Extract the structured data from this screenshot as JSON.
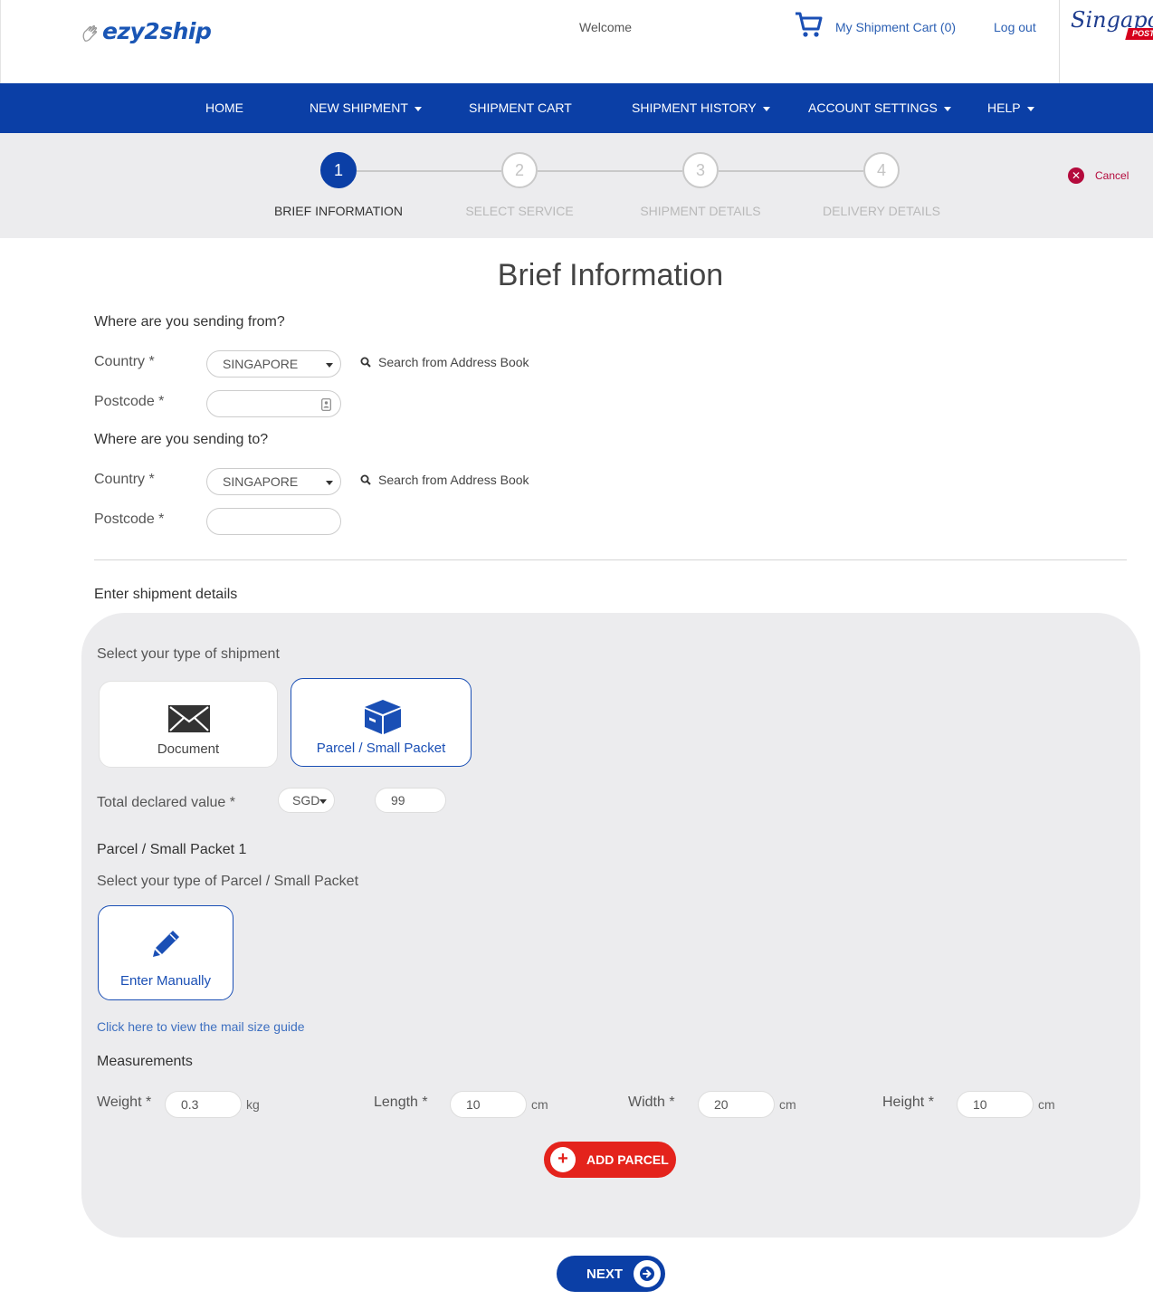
{
  "header": {
    "logo_text": "ezy2ship",
    "welcome": "Welcome",
    "cart_label": "My Shipment Cart (0)",
    "logout_label": "Log out",
    "partner_logo_text": "Singapore",
    "partner_logo_sub": "POST"
  },
  "nav": {
    "items": [
      {
        "label": "HOME",
        "has_dropdown": false
      },
      {
        "label": "NEW SHIPMENT",
        "has_dropdown": true
      },
      {
        "label": "SHIPMENT CART",
        "has_dropdown": false
      },
      {
        "label": "SHIPMENT HISTORY",
        "has_dropdown": true
      },
      {
        "label": "ACCOUNT SETTINGS",
        "has_dropdown": true
      },
      {
        "label": "HELP",
        "has_dropdown": true
      }
    ]
  },
  "stepper": {
    "current_step": 1,
    "steps": [
      {
        "number": "1",
        "label": "BRIEF INFORMATION"
      },
      {
        "number": "2",
        "label": "SELECT SERVICE"
      },
      {
        "number": "3",
        "label": "SHIPMENT DETAILS"
      },
      {
        "number": "4",
        "label": "DELIVERY DETAILS"
      }
    ],
    "cancel_label": "Cancel"
  },
  "page_title": "Brief Information",
  "from": {
    "heading": "Where are you sending from?",
    "country_label": "Country *",
    "country_value": "SINGAPORE",
    "address_book_label": "Search from Address Book",
    "postcode_label": "Postcode *",
    "postcode_value": ""
  },
  "to": {
    "heading": "Where are you sending to?",
    "country_label": "Country *",
    "country_value": "SINGAPORE",
    "address_book_label": "Search from Address Book",
    "postcode_label": "Postcode *",
    "postcode_value": ""
  },
  "shipment": {
    "heading": "Enter shipment details",
    "type_prompt": "Select your type of shipment",
    "types": [
      {
        "label": "Document",
        "icon": "envelope-icon",
        "selected": false
      },
      {
        "label": "Parcel / Small Packet",
        "icon": "box-icon",
        "selected": true
      }
    ],
    "declared_label": "Total declared value *",
    "currency": "SGD",
    "declared_value": "99"
  },
  "parcel": {
    "heading": "Parcel / Small Packet 1",
    "type_prompt": "Select your type of Parcel / Small Packet",
    "option_label": "Enter Manually",
    "size_guide_link": "Click here to view the mail size guide",
    "measurements_heading": "Measurements",
    "weight_label": "Weight *",
    "weight_value": "0.3",
    "weight_unit": "kg",
    "length_label": "Length *",
    "length_value": "10",
    "width_label": "Width *",
    "width_value": "20",
    "height_label": "Height *",
    "height_value": "10",
    "dim_unit": "cm"
  },
  "actions": {
    "add_parcel": "ADD PARCEL",
    "next": "NEXT"
  },
  "colors": {
    "brand_blue": "#0b3fa6",
    "accent_red": "#e4231c",
    "cancel_red": "#b40a3c",
    "panel_grey": "#ececee"
  }
}
